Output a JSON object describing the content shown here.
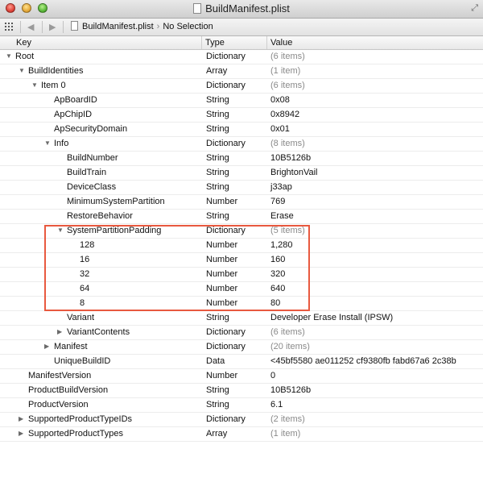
{
  "window": {
    "title": "BuildManifest.plist"
  },
  "pathbar": {
    "file": "BuildManifest.plist",
    "selection": "No Selection"
  },
  "columns": {
    "key": "Key",
    "type": "Type",
    "value": "Value"
  },
  "rows": [
    {
      "key": "Root",
      "type": "Dictionary",
      "value": "(6 items)",
      "depth": 0,
      "disclosure": "open",
      "muted": true
    },
    {
      "key": "BuildIdentities",
      "type": "Array",
      "value": "(1 item)",
      "depth": 1,
      "disclosure": "open",
      "muted": true
    },
    {
      "key": "Item 0",
      "type": "Dictionary",
      "value": "(6 items)",
      "depth": 2,
      "disclosure": "open",
      "muted": true
    },
    {
      "key": "ApBoardID",
      "type": "String",
      "value": "0x08",
      "depth": 3,
      "disclosure": "none",
      "muted": false
    },
    {
      "key": "ApChipID",
      "type": "String",
      "value": "0x8942",
      "depth": 3,
      "disclosure": "none",
      "muted": false
    },
    {
      "key": "ApSecurityDomain",
      "type": "String",
      "value": "0x01",
      "depth": 3,
      "disclosure": "none",
      "muted": false
    },
    {
      "key": "Info",
      "type": "Dictionary",
      "value": "(8 items)",
      "depth": 3,
      "disclosure": "open",
      "muted": true
    },
    {
      "key": "BuildNumber",
      "type": "String",
      "value": "10B5126b",
      "depth": 4,
      "disclosure": "none",
      "muted": false
    },
    {
      "key": "BuildTrain",
      "type": "String",
      "value": "BrightonVail",
      "depth": 4,
      "disclosure": "none",
      "muted": false
    },
    {
      "key": "DeviceClass",
      "type": "String",
      "value": "j33ap",
      "depth": 4,
      "disclosure": "none",
      "muted": false
    },
    {
      "key": "MinimumSystemPartition",
      "type": "Number",
      "value": "769",
      "depth": 4,
      "disclosure": "none",
      "muted": false
    },
    {
      "key": "RestoreBehavior",
      "type": "String",
      "value": "Erase",
      "depth": 4,
      "disclosure": "none",
      "muted": false
    },
    {
      "key": "SystemPartitionPadding",
      "type": "Dictionary",
      "value": "(5 items)",
      "depth": 4,
      "disclosure": "open",
      "muted": true
    },
    {
      "key": "128",
      "type": "Number",
      "value": "1,280",
      "depth": 5,
      "disclosure": "none",
      "muted": false
    },
    {
      "key": "16",
      "type": "Number",
      "value": "160",
      "depth": 5,
      "disclosure": "none",
      "muted": false
    },
    {
      "key": "32",
      "type": "Number",
      "value": "320",
      "depth": 5,
      "disclosure": "none",
      "muted": false
    },
    {
      "key": "64",
      "type": "Number",
      "value": "640",
      "depth": 5,
      "disclosure": "none",
      "muted": false
    },
    {
      "key": "8",
      "type": "Number",
      "value": "80",
      "depth": 5,
      "disclosure": "none",
      "muted": false
    },
    {
      "key": "Variant",
      "type": "String",
      "value": "Developer Erase Install (IPSW)",
      "depth": 4,
      "disclosure": "none",
      "muted": false
    },
    {
      "key": "VariantContents",
      "type": "Dictionary",
      "value": "(6 items)",
      "depth": 4,
      "disclosure": "closed",
      "muted": true
    },
    {
      "key": "Manifest",
      "type": "Dictionary",
      "value": "(20 items)",
      "depth": 3,
      "disclosure": "closed",
      "muted": true
    },
    {
      "key": "UniqueBuildID",
      "type": "Data",
      "value": "<45bf5580 ae011252 cf9380fb fabd67a6 2c38b",
      "depth": 3,
      "disclosure": "none",
      "muted": false
    },
    {
      "key": "ManifestVersion",
      "type": "Number",
      "value": "0",
      "depth": 1,
      "disclosure": "none",
      "muted": false
    },
    {
      "key": "ProductBuildVersion",
      "type": "String",
      "value": "10B5126b",
      "depth": 1,
      "disclosure": "none",
      "muted": false
    },
    {
      "key": "ProductVersion",
      "type": "String",
      "value": "6.1",
      "depth": 1,
      "disclosure": "none",
      "muted": false
    },
    {
      "key": "SupportedProductTypeIDs",
      "type": "Dictionary",
      "value": "(2 items)",
      "depth": 1,
      "disclosure": "closed",
      "muted": true
    },
    {
      "key": "SupportedProductTypes",
      "type": "Array",
      "value": "(1 item)",
      "depth": 1,
      "disclosure": "closed",
      "muted": true
    }
  ]
}
